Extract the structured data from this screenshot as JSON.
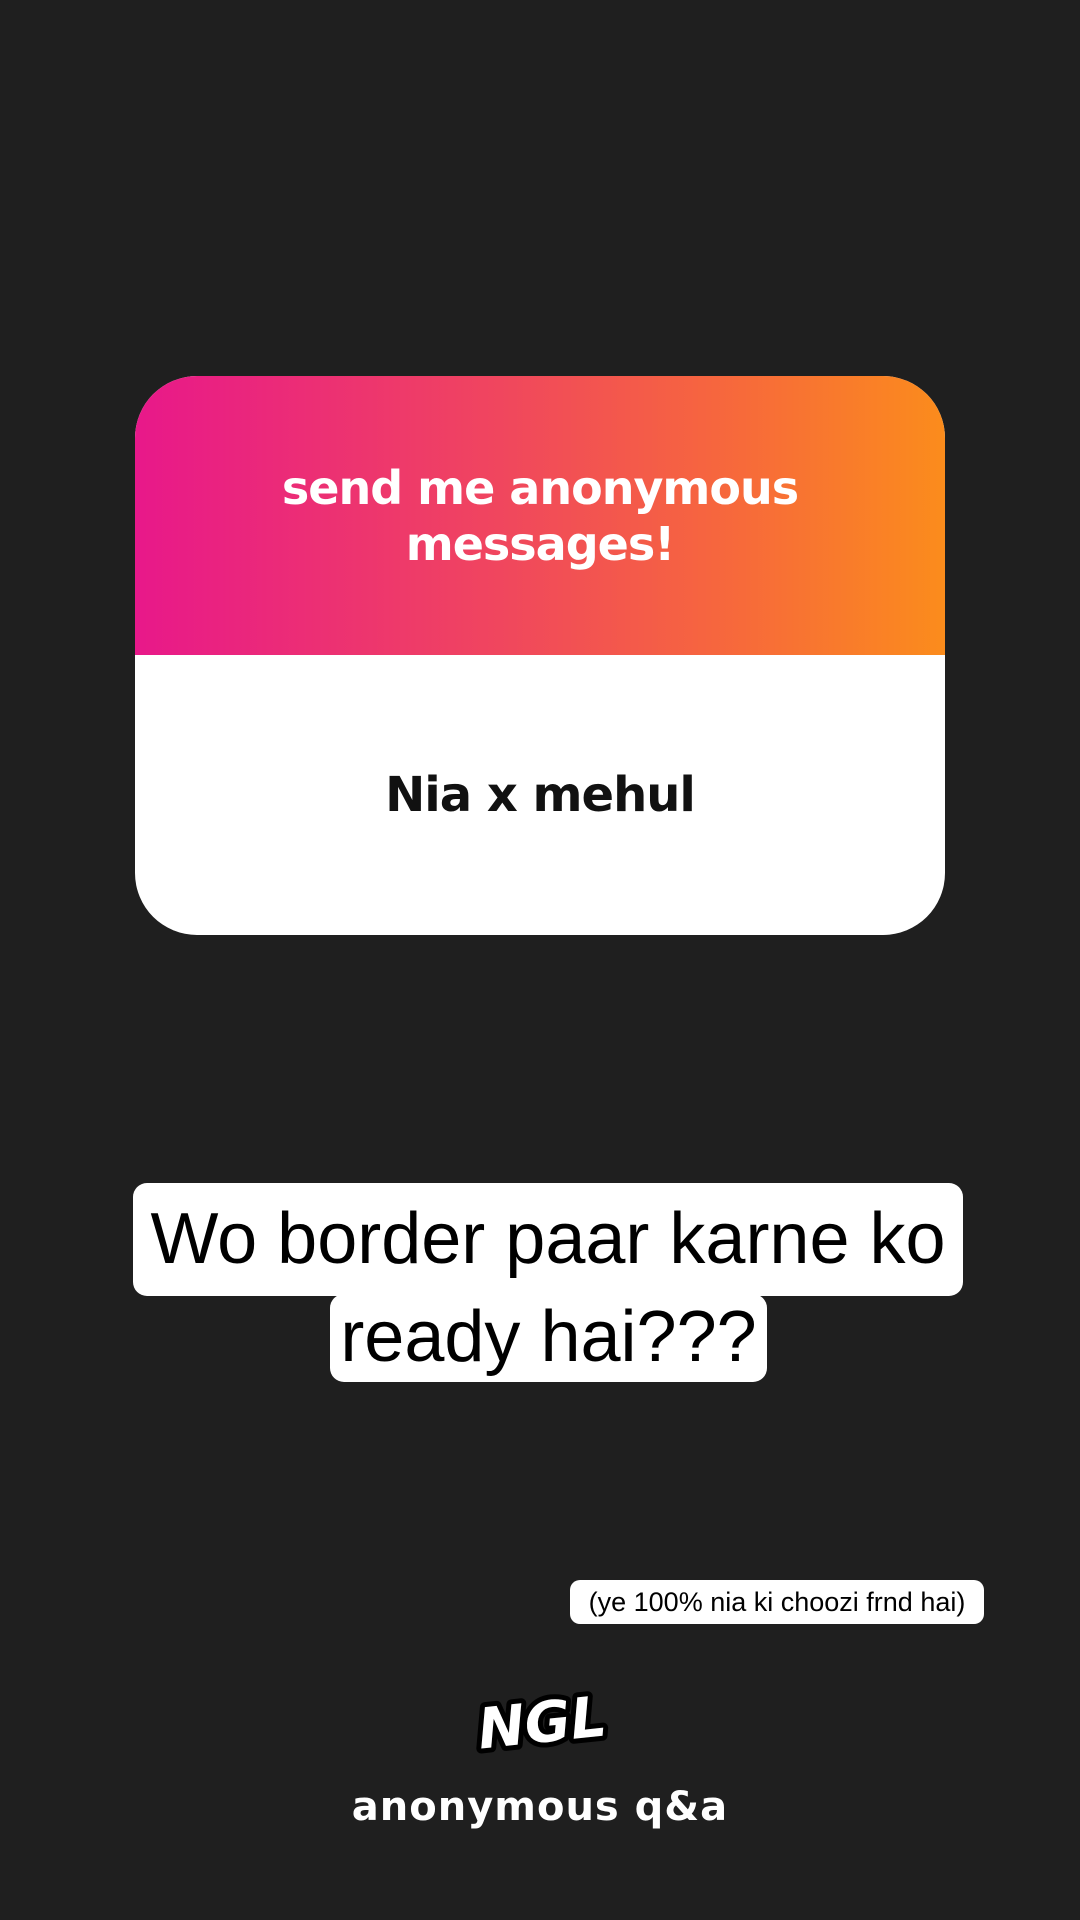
{
  "card": {
    "title": "send me anonymous messages!",
    "answer": "Nia x mehul",
    "gradient_colors": [
      "#e8188a",
      "#f0465e",
      "#f76a3a",
      "#fb8c1c"
    ]
  },
  "question": {
    "line1": "Wo border paar karne ko",
    "line2": "ready hai???"
  },
  "note": {
    "text": "(ye 100% nia ki choozi frnd hai)"
  },
  "branding": {
    "logo": "NGL",
    "subtitle": "anonymous q&a"
  },
  "colors": {
    "background": "#1f1f1f",
    "card_body": "#ffffff",
    "text_primary": "#000000",
    "text_on_dark": "#ffffff"
  }
}
